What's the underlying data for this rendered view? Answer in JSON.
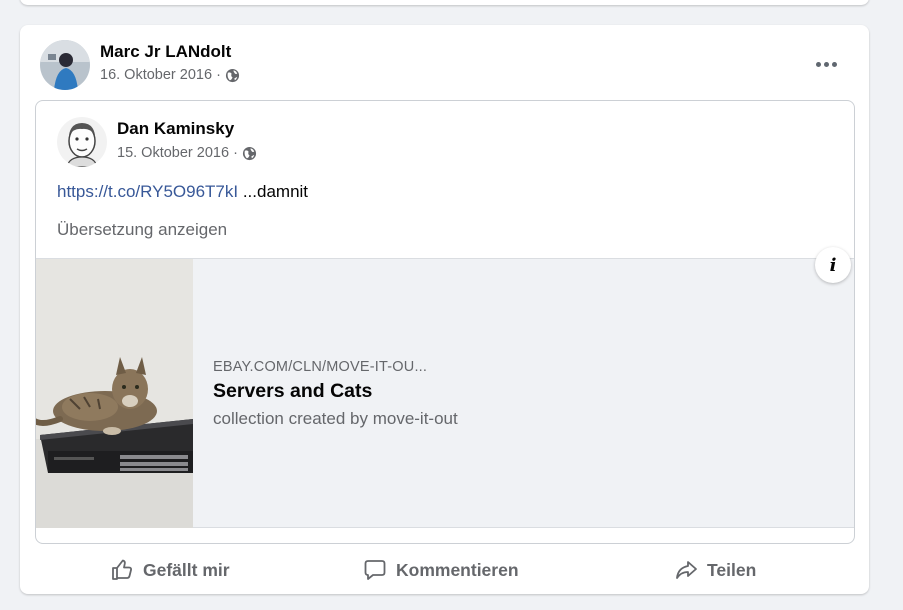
{
  "post": {
    "author_name": "Marc Jr LANdolt",
    "date": "16. Oktober 2016 ·",
    "more_label": "•••"
  },
  "shared_post": {
    "author_name": "Dan Kaminsky",
    "date": "15. Oktober 2016 ·",
    "link_text": "https://t.co/RY5O96T7kI",
    "text_after_link": " ...damnit",
    "translate_label": "Übersetzung anzeigen"
  },
  "link_preview": {
    "domain": "EBAY.COM/CLN/MOVE-IT-OU...",
    "title": "Servers and Cats",
    "description": "collection created by move-it-out",
    "info_label": "i"
  },
  "actions": {
    "like": "Gefällt mir",
    "comment": "Kommentieren",
    "share": "Teilen"
  },
  "icons": {
    "privacy": "globe-icon",
    "like": "thumbs-up-icon",
    "comment": "speech-bubble-icon",
    "share": "share-arrow-icon",
    "info": "info-icon"
  },
  "colors": {
    "link": "#385898",
    "secondary_text": "#65676b",
    "background": "#f0f2f5"
  }
}
